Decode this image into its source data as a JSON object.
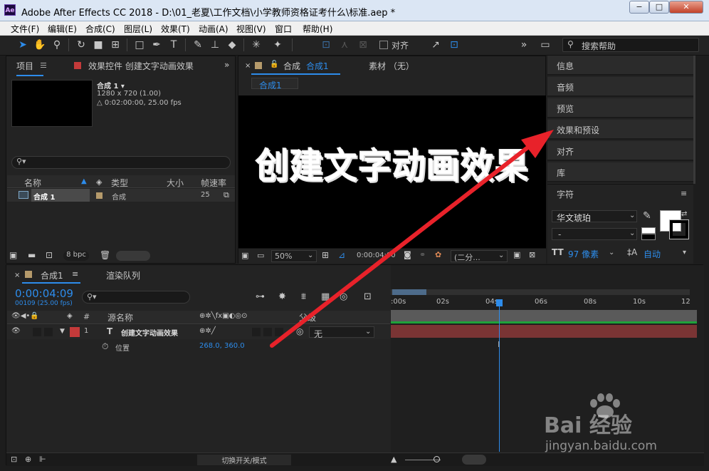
{
  "window": {
    "title": "Adobe After Effects CC 2018 - D:\\01_老夏\\工作文档\\小学教师资格证考什么\\标准.aep *",
    "app_icon": "Ae",
    "minimize": "−",
    "maximize": "□",
    "close": "✕"
  },
  "menu": [
    "文件(F)",
    "编辑(E)",
    "合成(C)",
    "图层(L)",
    "效果(T)",
    "动画(A)",
    "视图(V)",
    "窗口",
    "帮助(H)"
  ],
  "toolbar": {
    "align_label": "对齐",
    "search_placeholder": "搜索帮助",
    "more": "»"
  },
  "project": {
    "tab": "项目",
    "effects_tab": "效果控件 创建文字动画效果",
    "comp_name": "合成 1 ▾",
    "comp_size": "1280 x 720 (1.00)",
    "comp_duration": "△ 0:02:00:00, 25.00 fps",
    "columns": {
      "name": "名称",
      "type": "类型",
      "size": "大小",
      "fps": "帧速率"
    },
    "row": {
      "name": "合成 1",
      "type": "合成",
      "fps": "25"
    },
    "bpc": "8 bpc"
  },
  "viewer": {
    "tab_comp": "合成",
    "tab_comp_name": "合成1",
    "tab_footage": "素材 （无）",
    "breadcrumb": "合成1",
    "canvas_text": "创建文字动画效果",
    "zoom": "50%",
    "timecode": "0:00:04:00",
    "resolution": "(二分..."
  },
  "right_panels": [
    "信息",
    "音频",
    "预览",
    "效果和预设",
    "对齐",
    "库"
  ],
  "character": {
    "title": "字符",
    "font": "华文琥珀",
    "style": "-",
    "size": "97 像素",
    "leading": "自动",
    "fill_color": "#ffffff",
    "stroke_color": "#000000"
  },
  "timeline": {
    "tab": "合成1",
    "render_tab": "渲染队列",
    "timecode": "0:00:04:09",
    "frame_info": "00109 (25.00 fps)",
    "col_hash": "#",
    "col_source": "源名称",
    "col_parent": "父级",
    "layer_num": "1",
    "layer_name": "创建文字动画效果",
    "parent_value": "无",
    "prop_name": "位置",
    "prop_value": "268.0, 360.0",
    "ruler": [
      ":00s",
      "02s",
      "04s",
      "06s",
      "08s",
      "10s",
      "12"
    ],
    "footer_toggle": "切换开关/模式",
    "layer_color": "#c43a3a",
    "accent": "#2d8ceb"
  },
  "watermark": {
    "brand": "Bai 经验",
    "url": "jingyan.baidu.com"
  }
}
